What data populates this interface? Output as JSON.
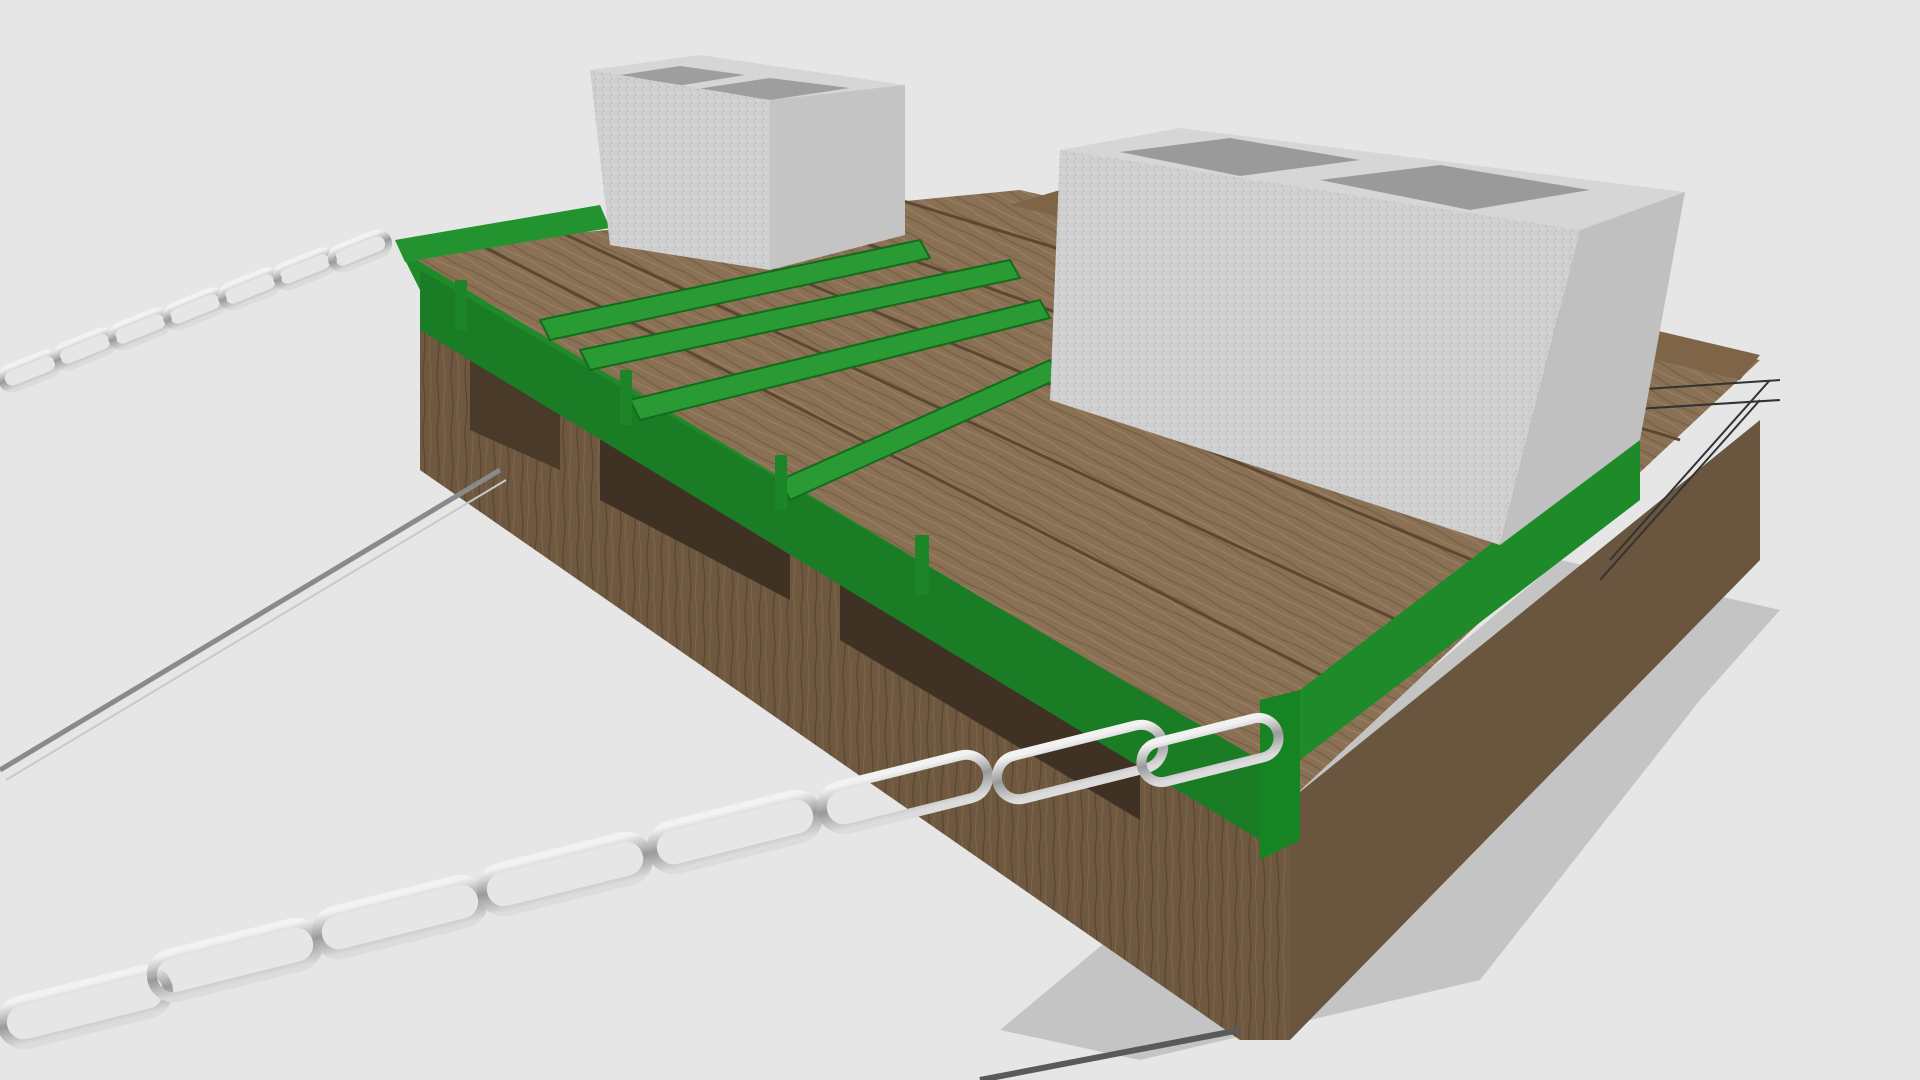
{
  "scene": {
    "subject": "wooden-pallet-with-cinder-blocks-and-chains",
    "colors": {
      "background": "#e6e6e6",
      "shadow": "#bdbdbd",
      "wood_light": "#8f7657",
      "wood_mid": "#7a6247",
      "wood_dark": "#5c4733",
      "wood_grain": "#6b553d",
      "green": "#1f8a2a",
      "green_dark": "#146b1d",
      "green_light": "#2fa83a",
      "block_top": "#d9d9d9",
      "block_side": "#c7c7c7",
      "block_front": "#bdbdbd",
      "block_hole": "#a8a8a8",
      "chain": "#b8b8b8",
      "chain_dark": "#6e6e6e"
    }
  }
}
